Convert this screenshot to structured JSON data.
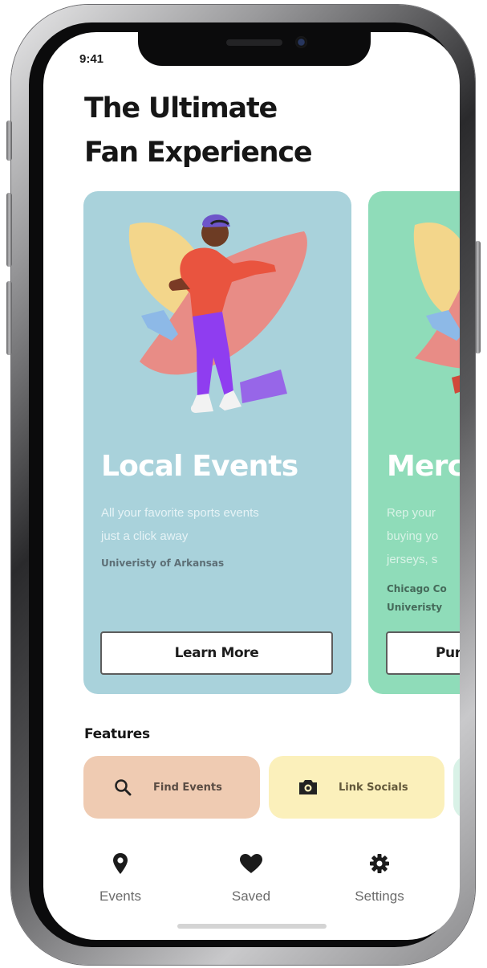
{
  "status_bar": {
    "time": "9:41"
  },
  "header": {
    "title_line1": "The Ultimate",
    "title_line2": "Fan Experience"
  },
  "cards": [
    {
      "title": "Local Events",
      "description_line1": "All your favorite sports events",
      "description_line2": "just a click away",
      "school": "Univeristy of Arkansas",
      "button_label": "Learn More",
      "background_color": "#a9d2db"
    },
    {
      "title": "Merc",
      "description_line1": "Rep your",
      "description_line2": "buying yo",
      "description_line3": "jerseys, s",
      "school_line1": "Chicago Co",
      "school_line2": "Univeristy",
      "button_label": "Pur",
      "background_color": "#8fdcb9"
    }
  ],
  "features": {
    "label": "Features",
    "items": [
      {
        "label": "Find Events",
        "icon": "search-icon",
        "color": "#efcbb2"
      },
      {
        "label": "Link Socials",
        "icon": "camera-icon",
        "color": "#fbf0bb"
      }
    ]
  },
  "bottom_nav": {
    "items": [
      {
        "label": "Events",
        "icon": "location-pin-icon"
      },
      {
        "label": "Saved",
        "icon": "heart-icon"
      },
      {
        "label": "Settings",
        "icon": "gear-icon"
      }
    ]
  }
}
